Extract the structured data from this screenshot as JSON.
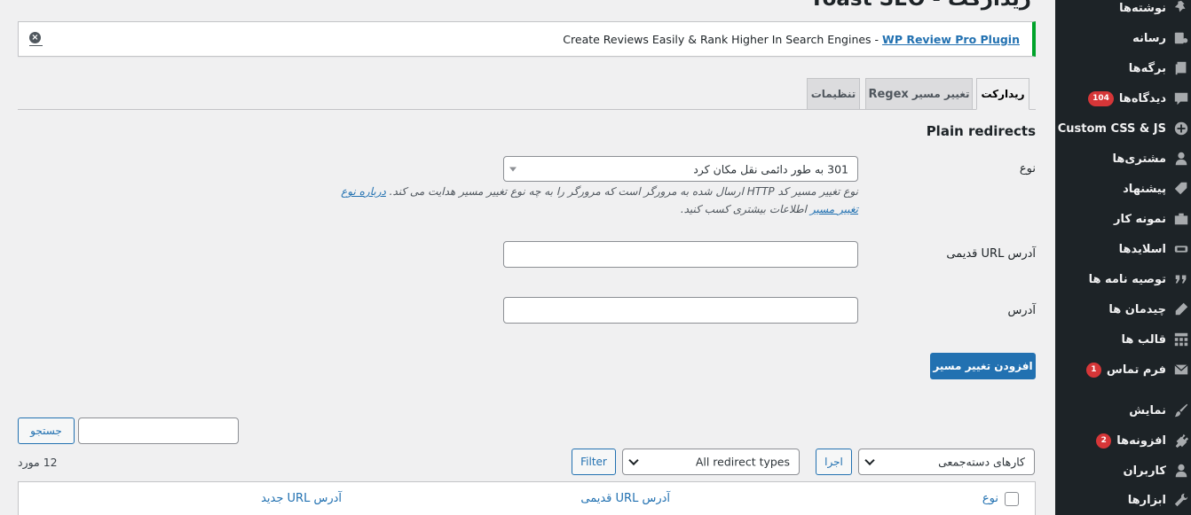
{
  "page": {
    "title": "ریدارکت - Yoast SEO"
  },
  "sidebar": {
    "items": [
      {
        "label": "نوشته‌ها",
        "icon": "pin-icon"
      },
      {
        "label": "رسانه",
        "icon": "media-icon"
      },
      {
        "label": "برگه‌ها",
        "icon": "pages-icon"
      },
      {
        "label": "دیدگاه‌ها",
        "icon": "comments-icon",
        "badge": "104"
      },
      {
        "label": "Custom CSS & JS",
        "icon": "plus-circle-icon"
      },
      {
        "label": "مشتری‌ها",
        "icon": "person-icon"
      },
      {
        "label": "پیشنهاد",
        "icon": "tag-icon"
      },
      {
        "label": "نمونه کار",
        "icon": "portfolio-icon"
      },
      {
        "label": "اسلایدها",
        "icon": "slides-icon"
      },
      {
        "label": "توصیه نامه ها",
        "icon": "quote-icon"
      },
      {
        "label": "چیدمان ها",
        "icon": "pencil-icon"
      },
      {
        "label": "قالب ها",
        "icon": "grid-icon"
      },
      {
        "label": "فرم تماس",
        "icon": "envelope-icon",
        "badge": "1"
      },
      {
        "label": "نمایش",
        "icon": "brush-icon"
      },
      {
        "label": "افزونه‌ها",
        "icon": "plugin-icon",
        "badge": "2"
      },
      {
        "label": "کاربران",
        "icon": "users-icon"
      },
      {
        "label": "ابزارها",
        "icon": "wrench-icon"
      }
    ]
  },
  "notice": {
    "text": "Create Reviews Easily & Rank Higher In Search Engines - ",
    "link": "WP Review Pro Plugin"
  },
  "tabs": [
    {
      "label": "ریدارکت",
      "active": true
    },
    {
      "label": "تغییر مسیر",
      "label_en": "Regex",
      "active": false
    },
    {
      "label": "تنظیمات",
      "active": false
    }
  ],
  "form": {
    "section_title": "Plain redirects",
    "type_label": "نوع",
    "type_value": "301 به طور دائمی نقل مکان کرد",
    "help_text": "نوع تغییر مسیر کد HTTP ارسال شده به مرورگر است که مرورگر را به چه نوع تغییر مسیر هدایت می کند.",
    "help_link": "درباره نوع تغییر مسیر",
    "help_text_end": "اطلاعات بیشتری کسب کنید.",
    "old_url_label": "آدرس URL قدیمی",
    "new_url_label": "آدرس",
    "submit_label": "افزودن تغییر مسیر"
  },
  "list": {
    "search_button": "جستجو",
    "search_value": "",
    "bulk_actions": "کارهای دسته‌جمعی",
    "apply_label": "اجرا",
    "type_filter": "All redirect types",
    "filter_label": "Filter",
    "items_count": "12 مورد",
    "columns": [
      "نوع",
      "آدرس URL قدیمی",
      "آدرس URL جدید"
    ]
  },
  "colors": {
    "sidebar_bg": "#1d2327",
    "primary": "#2271b1",
    "notice_border": "#00a32a",
    "badge": "#d63638"
  }
}
